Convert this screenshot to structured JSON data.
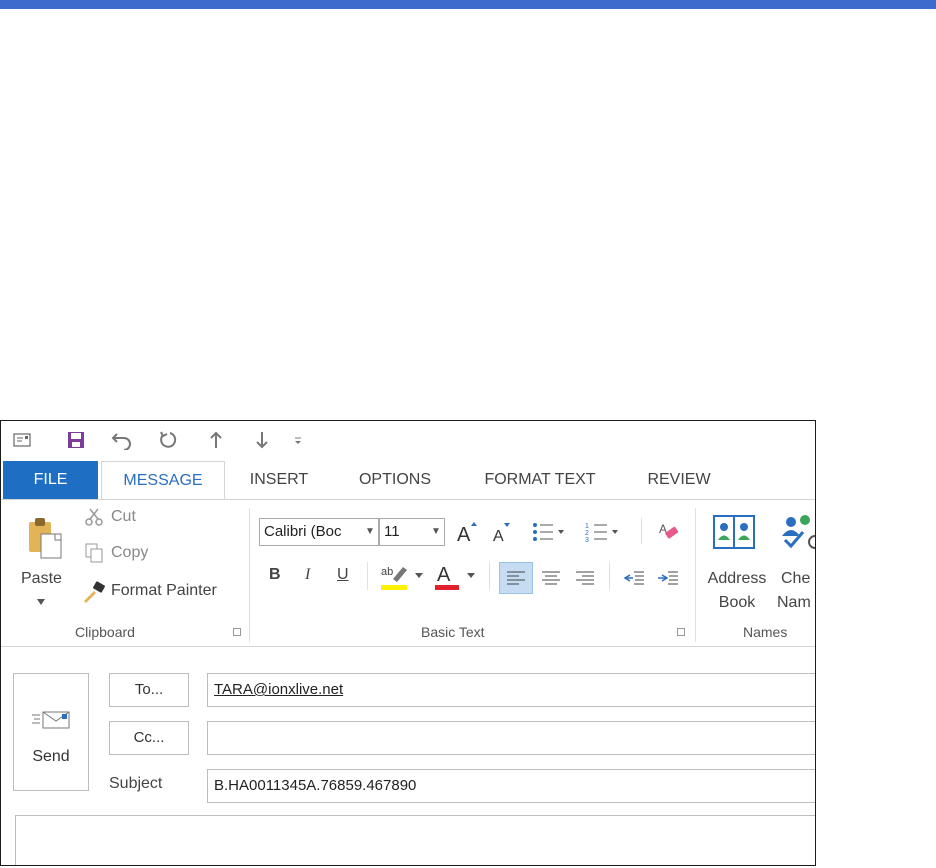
{
  "quick_access": {
    "icons": [
      "envelope-icon",
      "save-icon",
      "undo-icon",
      "redo-icon",
      "up-arrow-icon",
      "down-arrow-icon",
      "customize-icon"
    ]
  },
  "tabs": [
    "FILE",
    "MESSAGE",
    "INSERT",
    "OPTIONS",
    "FORMAT TEXT",
    "REVIEW"
  ],
  "clipboard": {
    "paste": "Paste",
    "cut": "Cut",
    "copy": "Copy",
    "format_painter": "Format Painter",
    "label": "Clipboard"
  },
  "basic_text": {
    "font_name": "Calibri (Boc",
    "font_size": "11",
    "bold": "B",
    "italic": "I",
    "underline": "U",
    "label": "Basic Text"
  },
  "names": {
    "address_book_line1": "Address",
    "address_book_line2": "Book",
    "check_names_line1": "Che",
    "check_names_line2": "Nam",
    "label": "Names"
  },
  "compose": {
    "send": "Send",
    "to_button": "To...",
    "cc_button": "Cc...",
    "subject_label": "Subject",
    "to_value": "TARA@ionxlive.net",
    "cc_value": "",
    "subject_value": "B.HA0011345A.76859.467890"
  },
  "colors": {
    "accent": "#3C6BCD",
    "file_tab": "#1E6FC4",
    "active_tab_text": "#2A6EC0",
    "highlight": "#FFF200",
    "font_color": "#E0202A"
  }
}
